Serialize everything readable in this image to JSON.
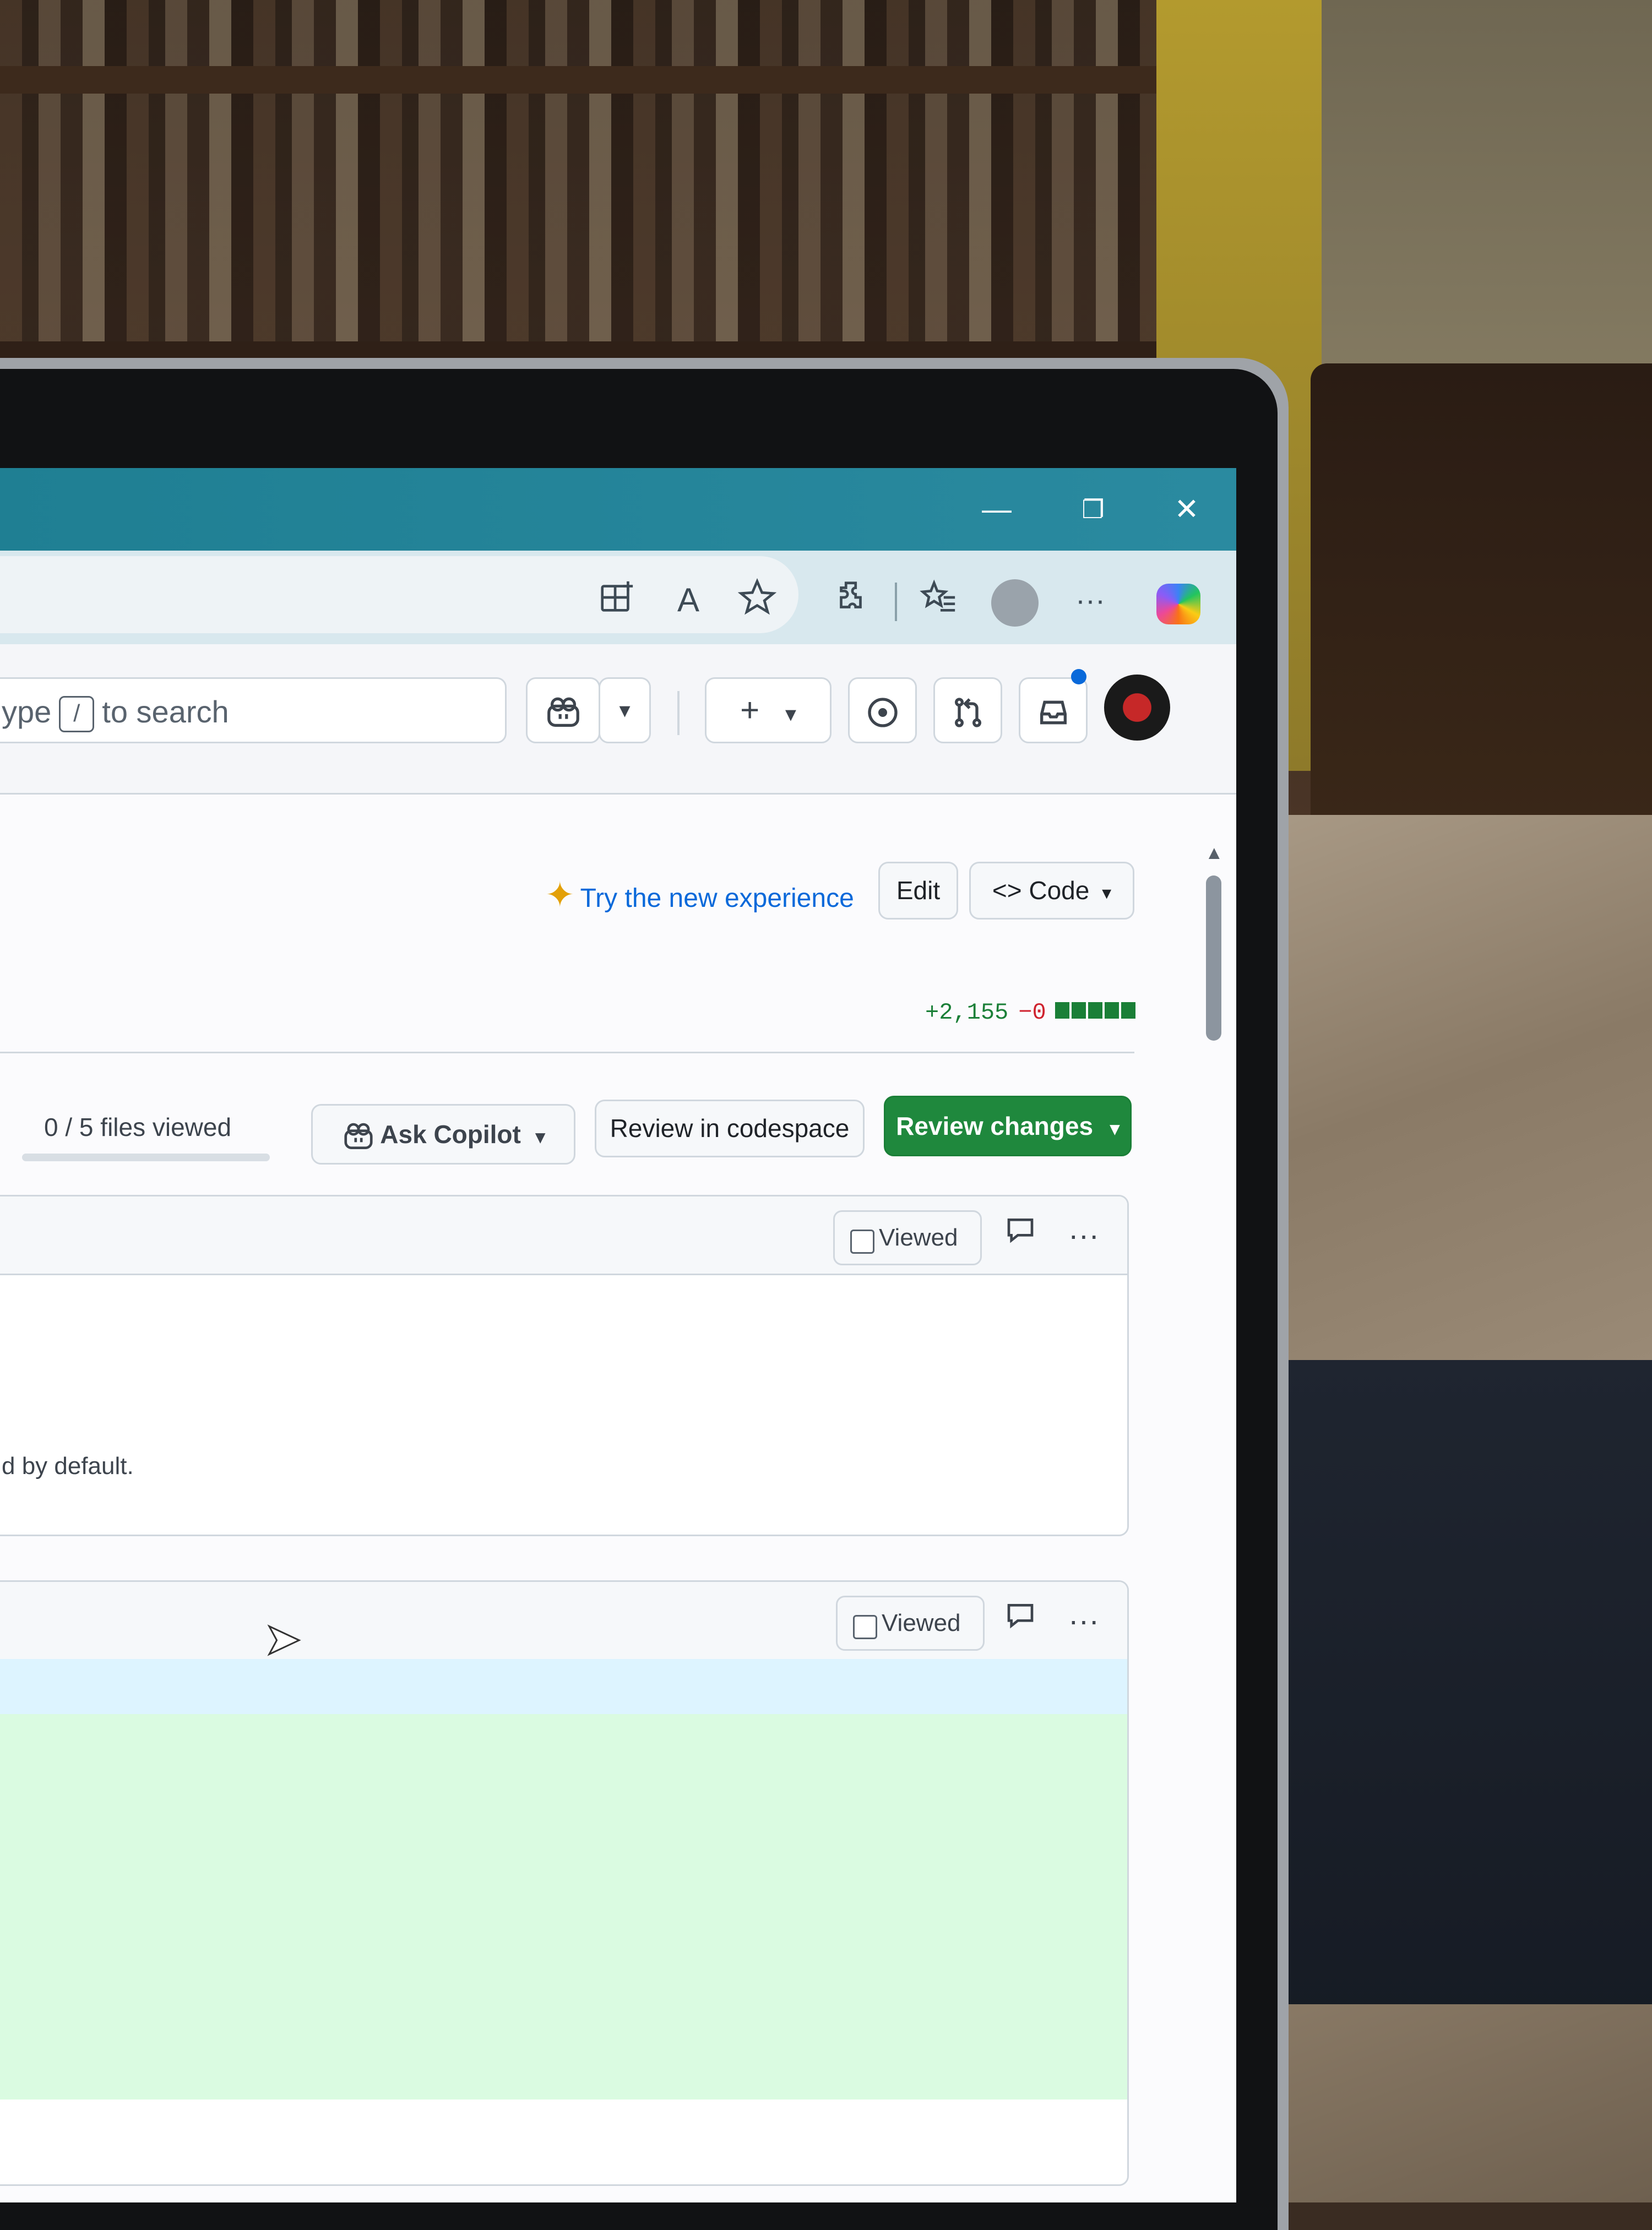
{
  "browser": {
    "window_controls": {
      "minimize": "—",
      "restore": "❐",
      "close": "✕"
    },
    "toolbar_icons": [
      "split-screen-icon",
      "read-aloud-icon",
      "favorite-star-icon",
      "extensions-icon",
      "favorites-icon",
      "profile-icon",
      "more-icon",
      "copilot-icon"
    ],
    "read_aloud_label": "A",
    "more_label": "···"
  },
  "header": {
    "search_prefix": "ype",
    "search_key": "/",
    "search_suffix": "to search",
    "plus_label": "+",
    "caret": "▾"
  },
  "actions": {
    "try_new": "Try the new experience",
    "edit": "Edit",
    "code": "Code",
    "code_icon": "<>"
  },
  "diffstat": {
    "additions": "+2,155",
    "deletions": "−0",
    "blocks": 5
  },
  "review": {
    "files_viewed": "0 / 5 files viewed",
    "files_viewed_progress": 0,
    "ask_copilot": "Ask Copilot",
    "review_in_codespace": "Review in codespace",
    "review_changes": "Review changes"
  },
  "files": [
    {
      "viewed_label": "Viewed",
      "snippet": "d by default."
    },
    {
      "viewed_label": "Viewed",
      "snippet": ""
    }
  ],
  "colors": {
    "titlebar": "#1f7f93",
    "link": "#0969da",
    "primary_button": "#1f883d",
    "additions": "#1a7f37",
    "deletions": "#cf222e"
  }
}
